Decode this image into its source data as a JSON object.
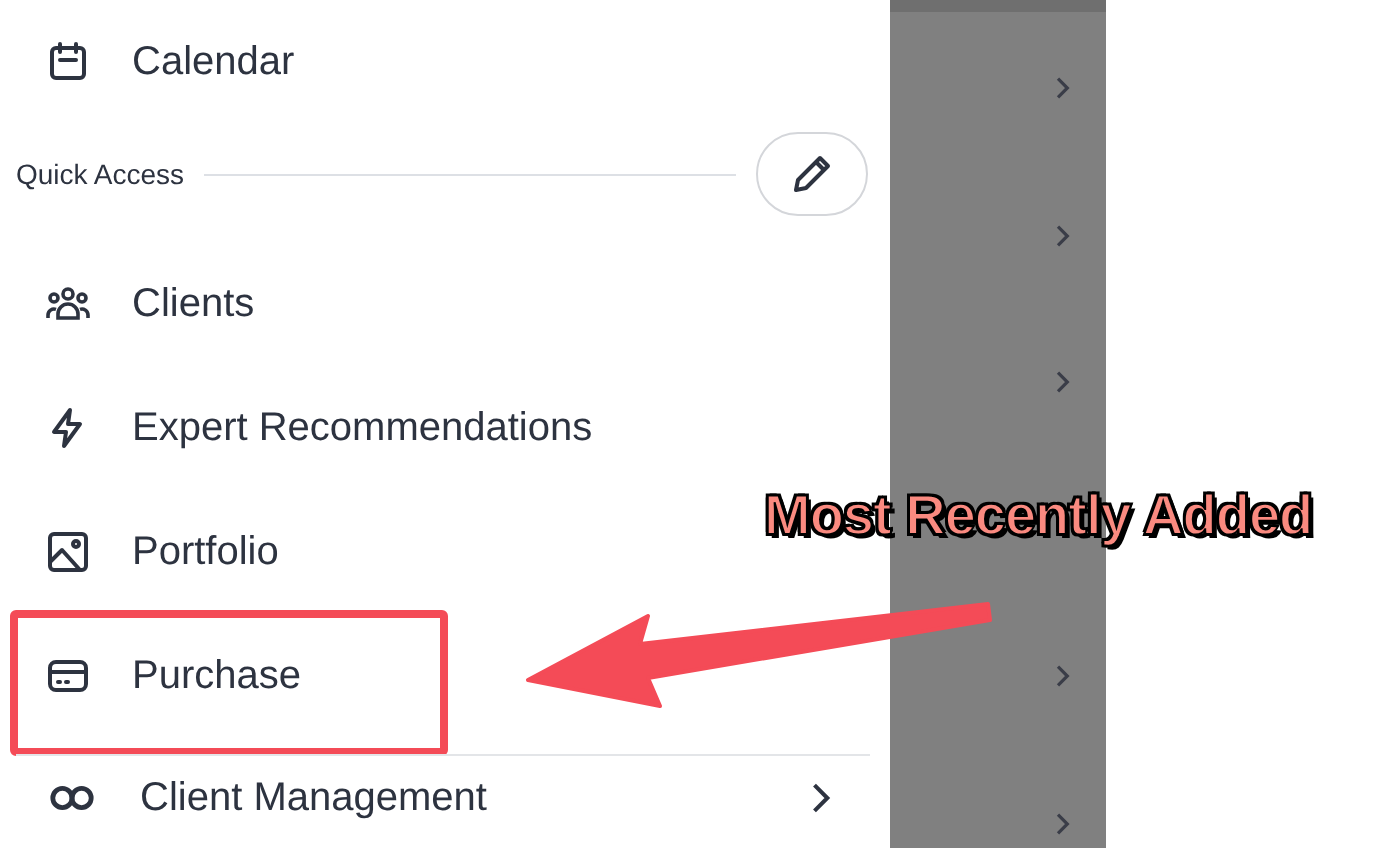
{
  "top_items": [
    {
      "label": "Calendar"
    }
  ],
  "section": {
    "title": "Quick Access"
  },
  "quick_items": [
    {
      "label": "Clients",
      "highlighted": false
    },
    {
      "label": "Expert Recommendations",
      "highlighted": false
    },
    {
      "label": "Portfolio",
      "highlighted": false
    },
    {
      "label": "Purchase",
      "highlighted": true
    }
  ],
  "bottom_items": [
    {
      "label": "Client Management",
      "expandable": true
    }
  ],
  "annotation": {
    "label": "Most Recently Added"
  }
}
